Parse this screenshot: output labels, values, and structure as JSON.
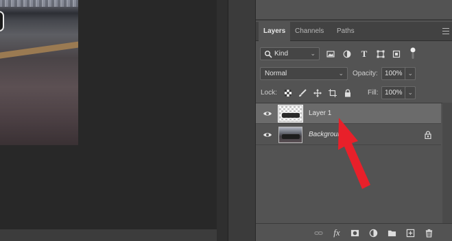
{
  "tabs": [
    {
      "label": "Layers",
      "active": true
    },
    {
      "label": "Channels",
      "active": false
    },
    {
      "label": "Paths",
      "active": false
    }
  ],
  "filter": {
    "value": "Kind"
  },
  "blend": {
    "mode": "Normal",
    "opacity_label": "Opacity:",
    "opacity_value": "100%"
  },
  "lock": {
    "label": "Lock:",
    "fill_label": "Fill:",
    "fill_value": "100%"
  },
  "layers": [
    {
      "name": "Layer 1",
      "selected": true,
      "visible": true
    },
    {
      "name": "Background",
      "selected": false,
      "visible": true,
      "locked": true
    }
  ],
  "footer_icons": [
    "link-icon",
    "fx-icon",
    "mask-icon",
    "adjustment-icon",
    "folder-icon",
    "new-layer-icon",
    "trash-icon"
  ],
  "footer_fx_label": "fx",
  "colors": {
    "annotation_arrow": "#e8202a",
    "panel_bg": "#535353",
    "selected_row": "#6b6b6b"
  }
}
